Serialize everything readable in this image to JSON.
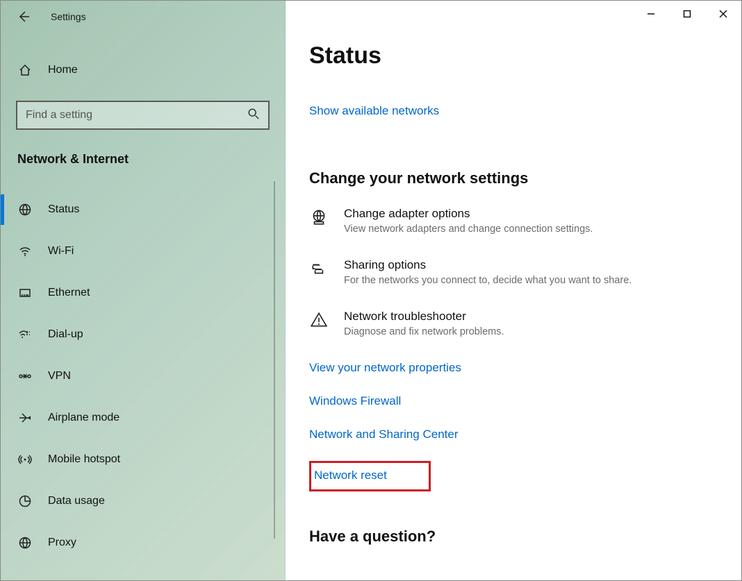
{
  "titlebar": {
    "app_title": "Settings"
  },
  "sidebar": {
    "home_label": "Home",
    "search_placeholder": "Find a setting",
    "section_label": "Network & Internet",
    "items": [
      {
        "label": "Status",
        "icon": "globe-icon",
        "active": true
      },
      {
        "label": "Wi-Fi",
        "icon": "wifi-icon"
      },
      {
        "label": "Ethernet",
        "icon": "ethernet-icon"
      },
      {
        "label": "Dial-up",
        "icon": "dialup-icon"
      },
      {
        "label": "VPN",
        "icon": "vpn-icon"
      },
      {
        "label": "Airplane mode",
        "icon": "airplane-icon"
      },
      {
        "label": "Mobile hotspot",
        "icon": "hotspot-icon"
      },
      {
        "label": "Data usage",
        "icon": "datausage-icon"
      },
      {
        "label": "Proxy",
        "icon": "proxy-icon"
      }
    ]
  },
  "main": {
    "page_title": "Status",
    "link_show_networks": "Show available networks",
    "section_change": "Change your network settings",
    "rows": [
      {
        "title": "Change adapter options",
        "desc": "View network adapters and change connection settings."
      },
      {
        "title": "Sharing options",
        "desc": "For the networks you connect to, decide what you want to share."
      },
      {
        "title": "Network troubleshooter",
        "desc": "Diagnose and fix network problems."
      }
    ],
    "link_properties": "View your network properties",
    "link_firewall": "Windows Firewall",
    "link_sharing": "Network and Sharing Center",
    "link_reset": "Network reset",
    "footer_heading": "Have a question?"
  }
}
